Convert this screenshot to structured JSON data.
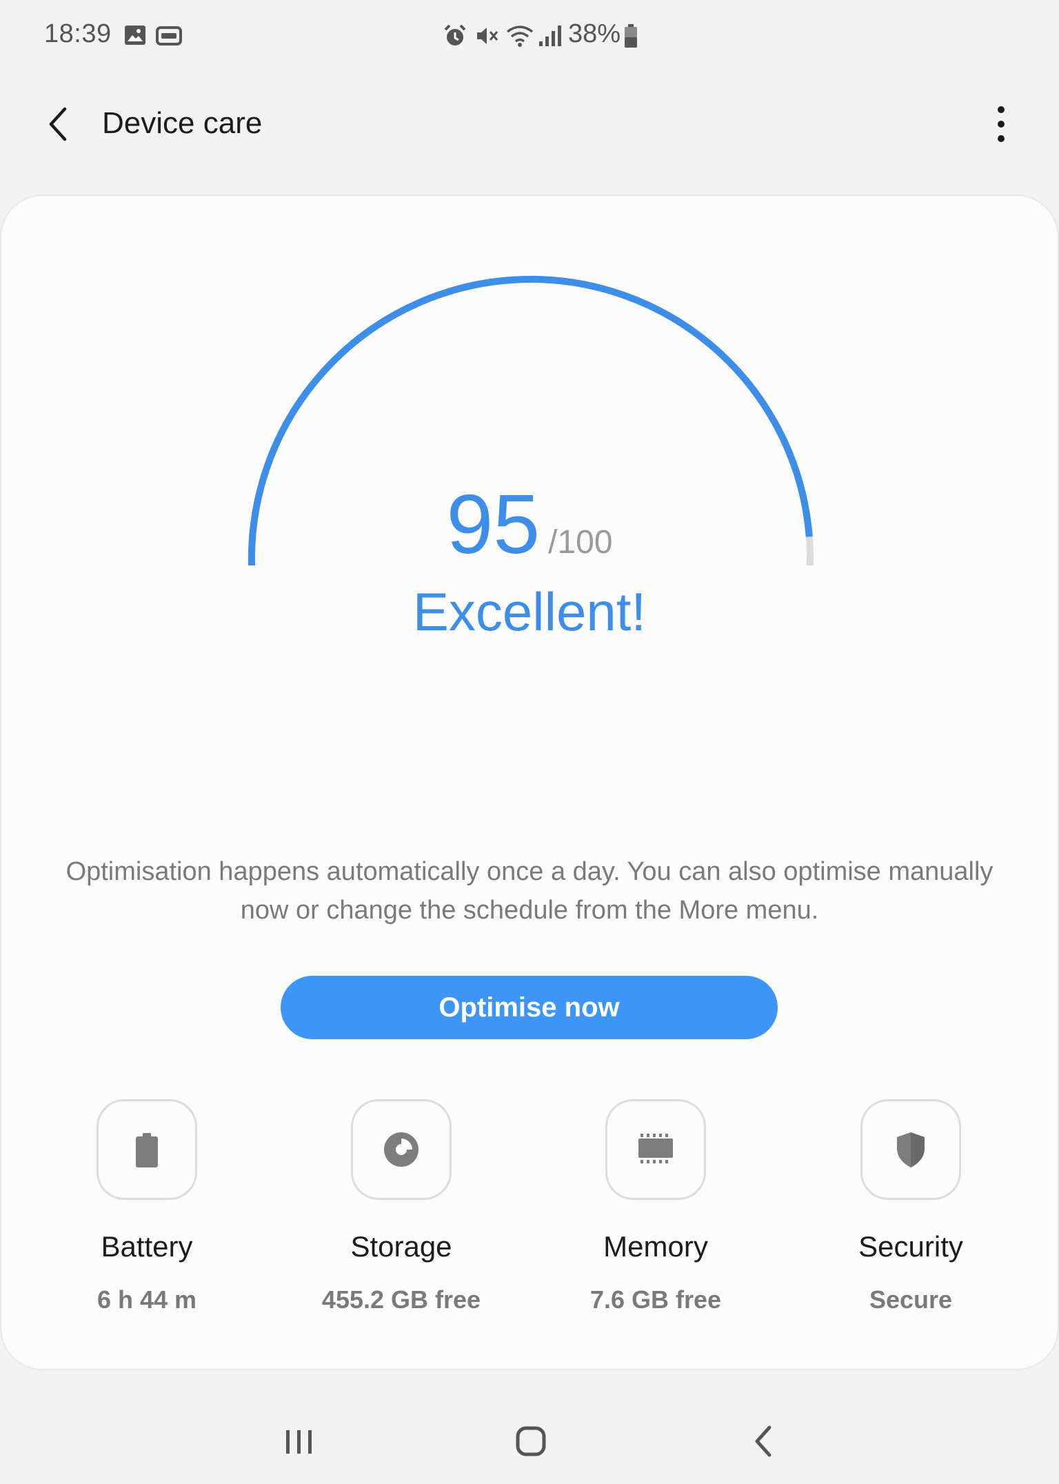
{
  "status_bar": {
    "time": "18:39",
    "battery_percent": "38%",
    "icons": [
      "image-icon",
      "card-icon",
      "alarm-icon",
      "mute-icon",
      "wifi-icon",
      "signal-icon",
      "battery-icon"
    ]
  },
  "app_bar": {
    "title": "Device care",
    "back_icon": "chevron-left-icon",
    "more_icon": "more-vertical-icon"
  },
  "score": {
    "value": "95",
    "max": "/100",
    "fraction": 0.95,
    "status": "Excellent!"
  },
  "description": "Optimisation happens automatically once a day. You can also optimise manually now or change the schedule from the More menu.",
  "actions": {
    "optimise_label": "Optimise now"
  },
  "tiles": [
    {
      "label": "Battery",
      "value": "6 h 44 m",
      "icon": "battery-icon"
    },
    {
      "label": "Storage",
      "value": "455.2 GB free",
      "icon": "storage-icon"
    },
    {
      "label": "Memory",
      "value": "7.6 GB free",
      "icon": "memory-chip-icon"
    },
    {
      "label": "Security",
      "value": "Secure",
      "icon": "shield-icon"
    }
  ],
  "nav": {
    "recents_icon": "recents-icon",
    "home_icon": "home-icon",
    "back_icon": "back-icon"
  },
  "colors": {
    "accent": "#3d8ee9",
    "button": "#3d95f5",
    "track": "#dcdcdc",
    "background": "#f2f2f2",
    "card": "#fcfcfc"
  }
}
